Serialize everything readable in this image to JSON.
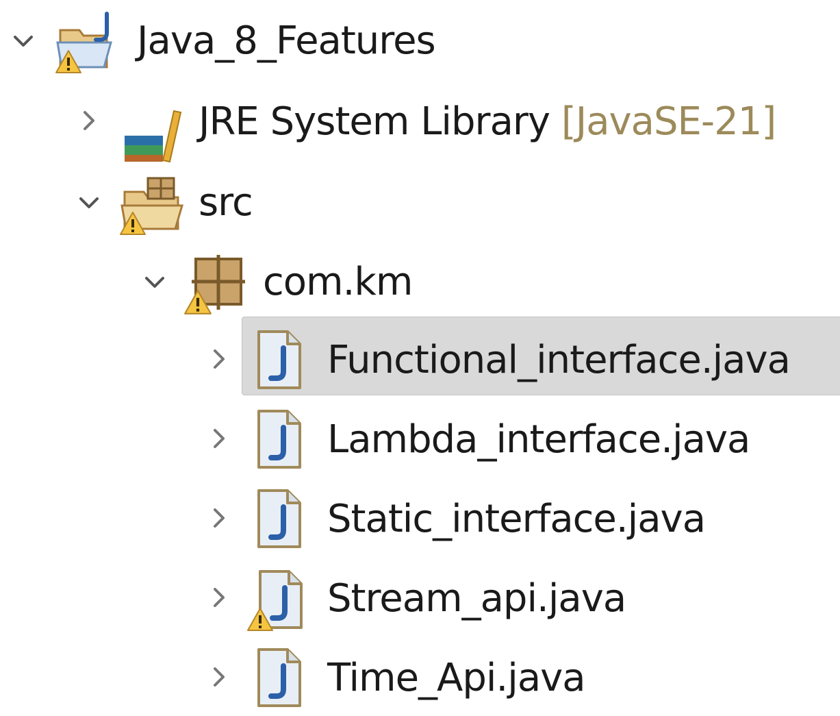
{
  "explorer": {
    "project": {
      "label": "Java_8_Features",
      "expanded": true,
      "icon": "java-project-warning-icon"
    },
    "jre": {
      "label": "JRE System Library",
      "decoration": "[JavaSE-21]",
      "icon": "library-books-icon"
    },
    "src": {
      "label": "src",
      "expanded": true,
      "icon": "source-folder-warning-icon"
    },
    "package": {
      "label": "com.km",
      "expanded": true,
      "icon": "package-warning-icon"
    },
    "files": [
      {
        "label": "Functional_interface.java",
        "selected": true,
        "warning": false,
        "icon": "java-file-icon"
      },
      {
        "label": "Lambda_interface.java",
        "selected": false,
        "warning": false,
        "icon": "java-file-icon"
      },
      {
        "label": "Static_interface.java",
        "selected": false,
        "warning": false,
        "icon": "java-file-icon"
      },
      {
        "label": "Stream_api.java",
        "selected": false,
        "warning": true,
        "icon": "java-file-warning-icon"
      },
      {
        "label": "Time_Api.java",
        "selected": false,
        "warning": false,
        "icon": "java-file-icon"
      }
    ],
    "colors": {
      "selection": "#d9d9d9",
      "decoration": "#9c8a5a",
      "warning": "#f5c542",
      "java_blue": "#2b5fa8"
    }
  }
}
